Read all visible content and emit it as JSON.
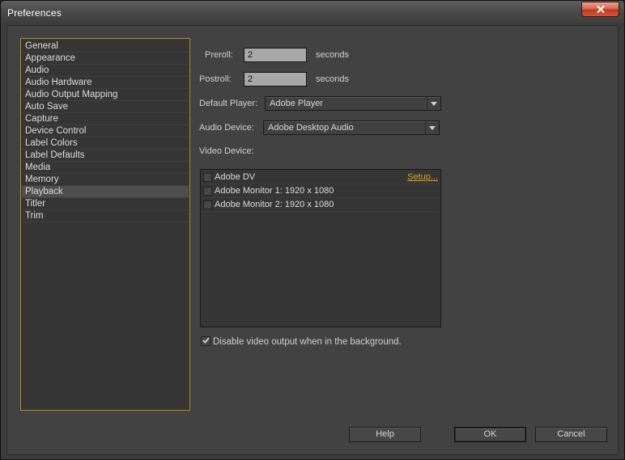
{
  "window": {
    "title": "Preferences"
  },
  "sidebar": {
    "items": [
      {
        "label": "General"
      },
      {
        "label": "Appearance"
      },
      {
        "label": "Audio"
      },
      {
        "label": "Audio Hardware"
      },
      {
        "label": "Audio Output Mapping"
      },
      {
        "label": "Auto Save"
      },
      {
        "label": "Capture"
      },
      {
        "label": "Device Control"
      },
      {
        "label": "Label Colors"
      },
      {
        "label": "Label Defaults"
      },
      {
        "label": "Media"
      },
      {
        "label": "Memory"
      },
      {
        "label": "Playback",
        "selected": true
      },
      {
        "label": "Titler"
      },
      {
        "label": "Trim"
      }
    ]
  },
  "playback": {
    "preroll": {
      "label": "Preroll:",
      "value": "2",
      "unit": "seconds"
    },
    "postroll": {
      "label": "Postroll:",
      "value": "2",
      "unit": "seconds"
    },
    "default_player": {
      "label": "Default Player:",
      "value": "Adobe Player"
    },
    "audio_device": {
      "label": "Audio Device:",
      "value": "Adobe Desktop Audio"
    },
    "video_device": {
      "label": "Video Device:",
      "devices": [
        {
          "label": "Adobe DV",
          "checked": false,
          "setup_label": "Setup..."
        },
        {
          "label": "Adobe Monitor 1: 1920 x 1080",
          "checked": false
        },
        {
          "label": "Adobe Monitor 2: 1920 x 1080",
          "checked": false
        }
      ]
    },
    "disable_background": {
      "label": "Disable video output when in the background.",
      "checked": true
    }
  },
  "buttons": {
    "help": "Help",
    "ok": "OK",
    "cancel": "Cancel"
  },
  "colors": {
    "accent": "#b58a16",
    "link": "#d9a11f",
    "close_button": "#c0391f"
  },
  "icons": {
    "close": "close-icon",
    "dropdown": "chevron-down-icon",
    "check": "checkmark-icon"
  }
}
